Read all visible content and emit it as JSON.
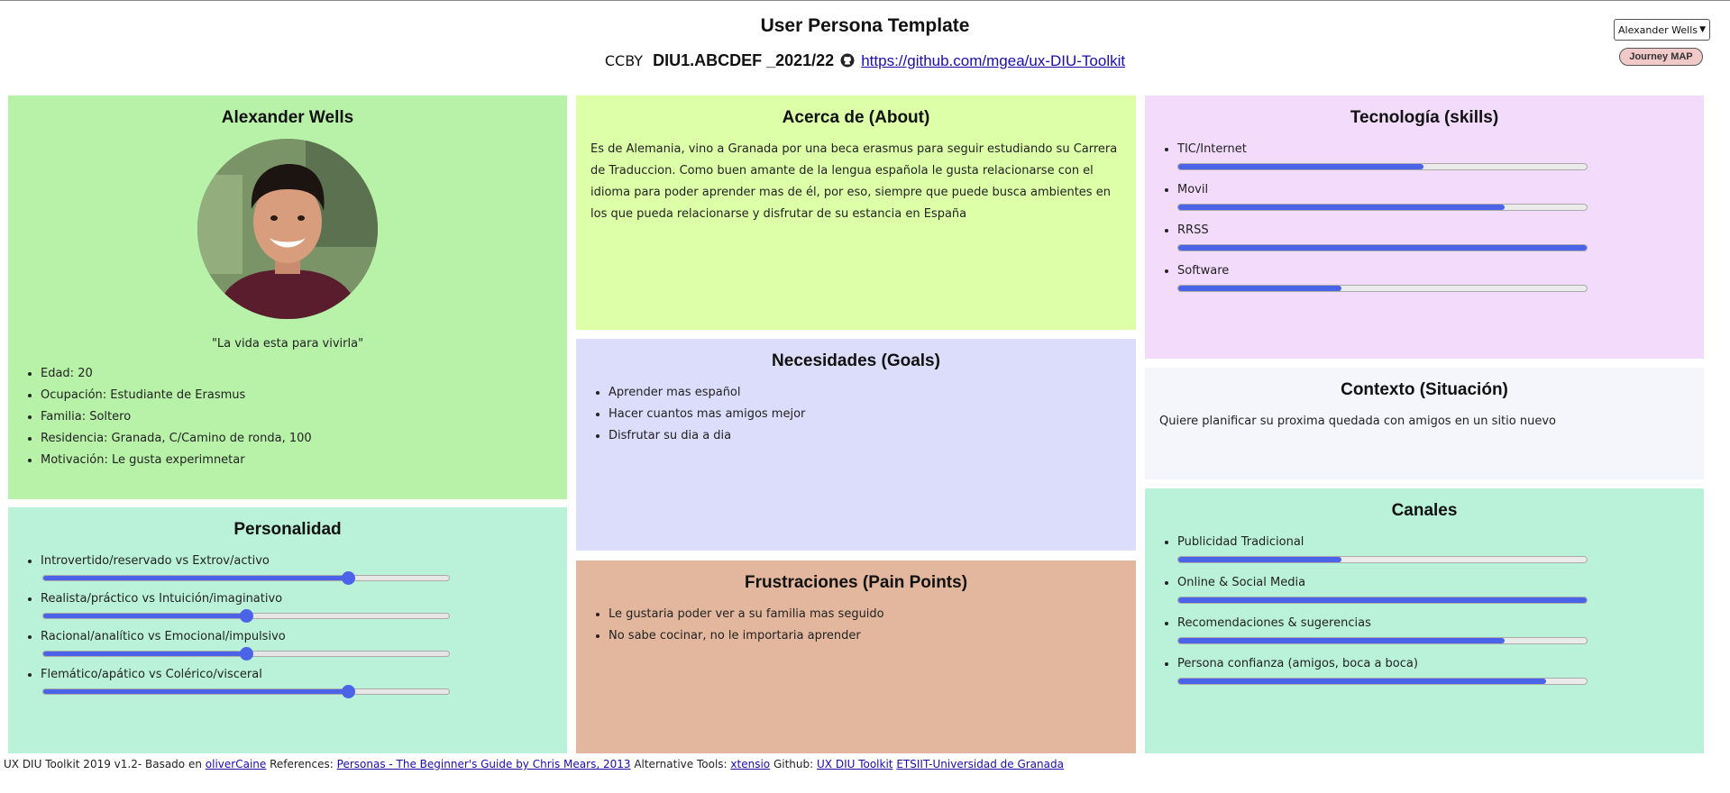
{
  "header": {
    "title": "User Persona Template",
    "license": "CCBY",
    "course_code": "DIU1.ABCDEF _2021/22",
    "repo_link": "https://github.com/mgea/ux-DIU-Toolkit"
  },
  "controls": {
    "persona_select_value": "Alexander Wells",
    "journey_map_label": "Journey MAP"
  },
  "profile": {
    "name": "Alexander Wells",
    "quote": "\"La vida esta para vivirla\"",
    "details": [
      "Edad: 20",
      "Ocupación: Estudiante de Erasmus",
      "Familia: Soltero",
      "Residencia: Granada, C/Camino de ronda, 100",
      "Motivación: Le gusta experimnetar"
    ]
  },
  "personality": {
    "title": "Personalidad",
    "traits": [
      {
        "label": "Introvertido/reservado vs Extrov/activo",
        "value": 0.75
      },
      {
        "label": "Realista/práctico vs Intuición/imaginativo",
        "value": 0.5
      },
      {
        "label": "Racional/analítico vs Emocional/impulsivo",
        "value": 0.5
      },
      {
        "label": "Flemático/apático vs Colérico/visceral",
        "value": 0.75
      }
    ]
  },
  "about": {
    "title": "Acerca de (About)",
    "text": "Es de Alemania, vino a Granada por una beca erasmus para seguir estudiando su Carrera de Traduccion. Como buen amante de la lengua española le gusta relacionarse con el idioma para poder aprender mas de él, por eso, siempre que puede busca ambientes en los que pueda relacionarse y disfrutar de su estancia en España"
  },
  "goals": {
    "title": "Necesidades (Goals)",
    "items": [
      "Aprender mas español",
      "Hacer cuantos mas amigos mejor",
      "Disfrutar su dia a dia"
    ]
  },
  "frustrations": {
    "title": "Frustraciones (Pain Points)",
    "items": [
      "Le gustaria poder ver a su familia mas seguido",
      "No sabe cocinar, no le importaria aprender"
    ]
  },
  "tech": {
    "title": "Tecnología (skills)",
    "items": [
      {
        "label": "TIC/Internet",
        "value": 0.6
      },
      {
        "label": "Movil",
        "value": 0.8
      },
      {
        "label": "RRSS",
        "value": 1.0
      },
      {
        "label": "Software",
        "value": 0.4
      }
    ]
  },
  "context": {
    "title": "Contexto (Situación)",
    "text": "Quiere planificar su proxima quedada con amigos en un sitio nuevo"
  },
  "channels": {
    "title": "Canales",
    "items": [
      {
        "label": "Publicidad Tradicional",
        "value": 0.4
      },
      {
        "label": "Online & Social Media",
        "value": 1.0
      },
      {
        "label": "Recomendaciones & sugerencias",
        "value": 0.8
      },
      {
        "label": "Persona confianza (amigos, boca a boca)",
        "value": 0.9
      }
    ]
  },
  "footer": {
    "credit": "UX DIU Toolkit 2019 v1.2- Basado en",
    "credit_link": "oliverCaine",
    "references_label": "References:",
    "references_link": "Personas - The Beginner's Guide by Chris Mears, 2013",
    "tools_label": "Alternative Tools:",
    "tools_link": "xtensio",
    "github_label": "Github:",
    "github_link": "UX DIU Toolkit",
    "etsiit_link": "ETSIIT-Universidad de Granada"
  },
  "colors": {
    "profile_bg": "#b8f2a8",
    "personality_bg": "#baf1d9",
    "about_bg": "#dcffa8",
    "goals_bg": "#dcdcfb",
    "frustrations_bg": "#e3b79e",
    "tech_bg": "#f2dbfb",
    "context_bg": "#f4f6fb",
    "channels_bg": "#baf1d9",
    "accent": "#4b63e6"
  }
}
